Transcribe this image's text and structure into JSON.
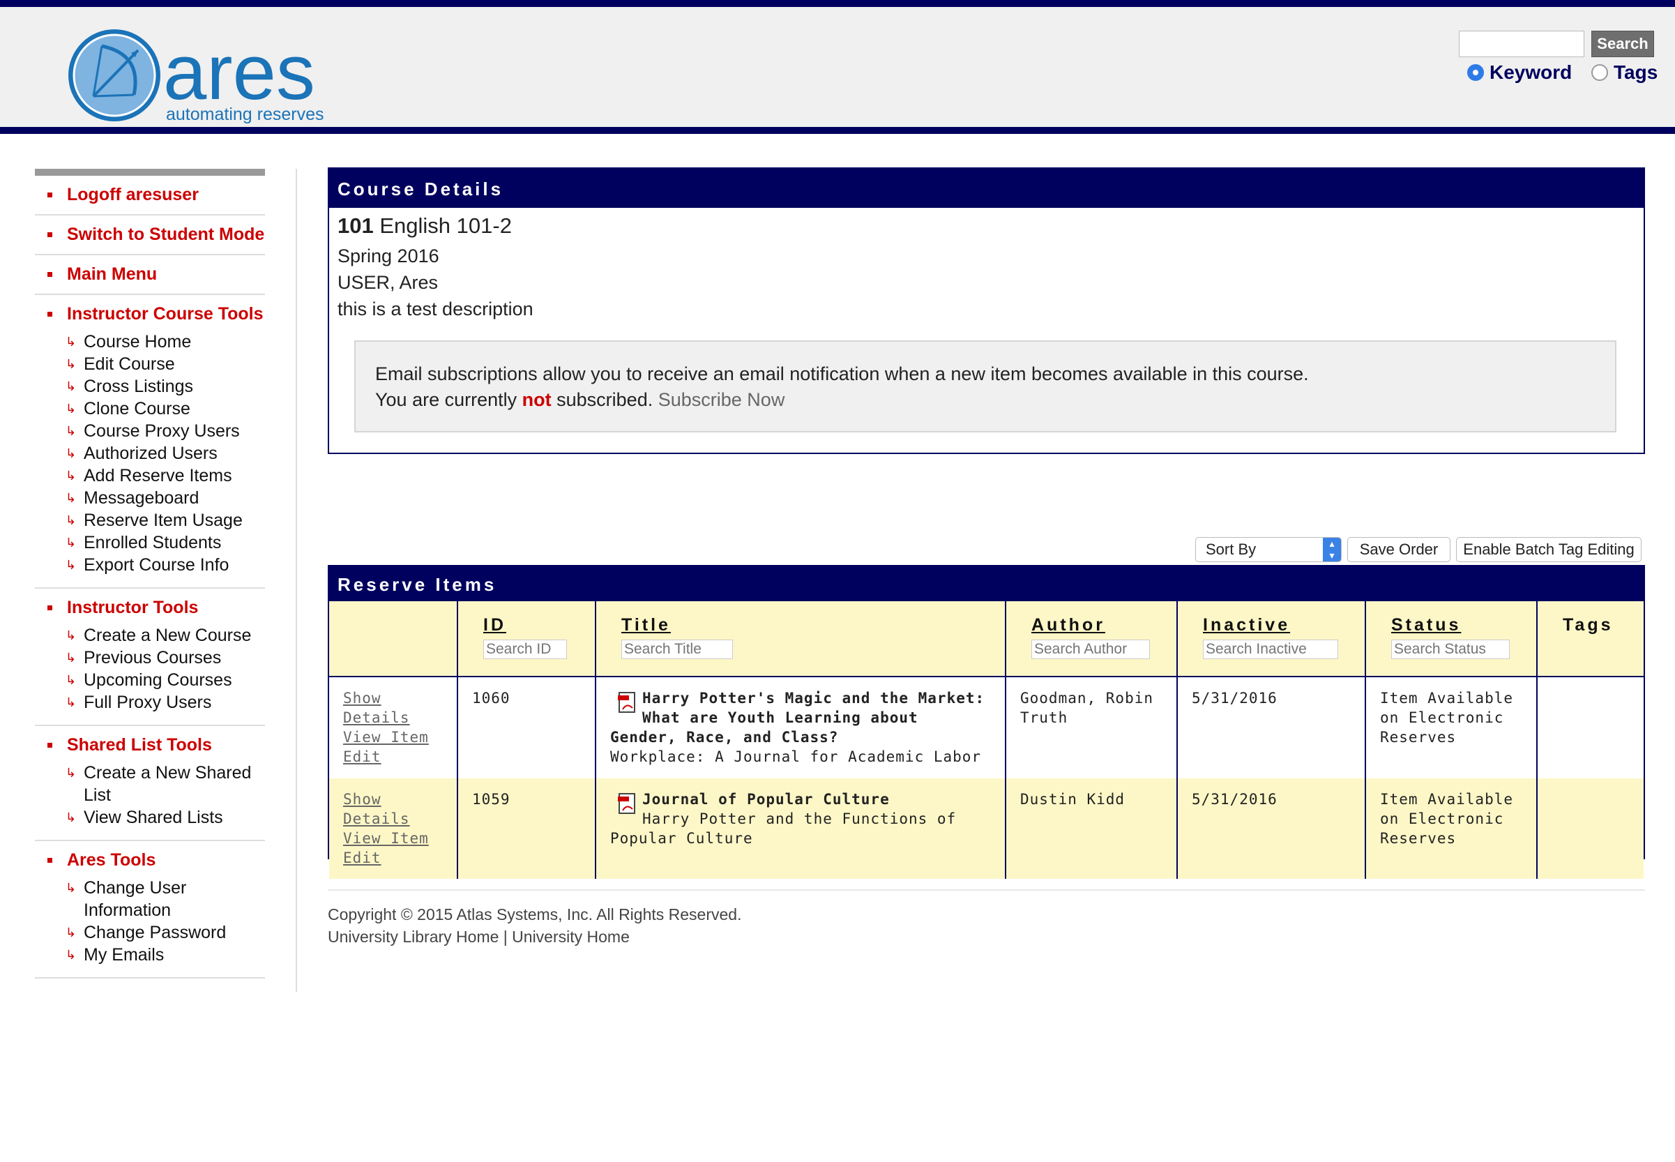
{
  "header": {
    "logo_text": "ares",
    "logo_tagline": "automating reserves",
    "search_value": "",
    "search_button": "Search",
    "radio_keyword": "Keyword",
    "radio_tags": "Tags",
    "selected_radio": "Keyword"
  },
  "sidebar": {
    "logoff": "Logoff aresuser",
    "switch_mode": "Switch to Student Mode",
    "main_menu": "Main Menu",
    "instructor_course_tools": {
      "title": "Instructor Course Tools",
      "items": [
        "Course Home",
        "Edit Course",
        "Cross Listings",
        "Clone Course",
        "Course Proxy Users",
        "Authorized Users",
        "Add Reserve Items",
        "Messageboard",
        "Reserve Item Usage",
        "Enrolled Students",
        "Export Course Info"
      ]
    },
    "instructor_tools": {
      "title": "Instructor Tools",
      "items": [
        "Create a New Course",
        "Previous Courses",
        "Upcoming Courses",
        "Full Proxy Users"
      ]
    },
    "shared_list_tools": {
      "title": "Shared List Tools",
      "items": [
        "Create a New Shared List",
        "View Shared Lists"
      ]
    },
    "ares_tools": {
      "title": "Ares Tools",
      "items": [
        "Change User Information",
        "Change Password",
        "My Emails"
      ]
    }
  },
  "course": {
    "panel_title": "Course Details",
    "number": "101",
    "name": "English 101-2",
    "semester": "Spring 2016",
    "instructor": "USER, Ares",
    "description": "this is a test description",
    "email_line1": "Email subscriptions allow you to receive an email notification when a new item becomes available in this course.",
    "email_line2_pre": "You are currently",
    "email_line2_not": "not",
    "email_line2_post": "subscribed.",
    "subscribe_link": "Subscribe Now"
  },
  "controls": {
    "sort_by": "Sort By",
    "save_order": "Save Order",
    "batch_tag": "Enable Batch Tag Editing"
  },
  "reserve": {
    "panel_title": "Reserve Items",
    "columns": {
      "id": "ID",
      "title": "Title",
      "author": "Author",
      "inactive": "Inactive",
      "status": "Status",
      "tags": "Tags"
    },
    "placeholders": {
      "id": "Search ID",
      "title": "Search Title",
      "author": "Search Author",
      "inactive": "Search Inactive",
      "status": "Search Status"
    },
    "rows": [
      {
        "actions": [
          "Show Details",
          "View Item",
          "Edit"
        ],
        "id": "1060",
        "title": "Harry Potter's Magic and the Market: What are Youth Learning about Gender, Race, and Class?",
        "subtitle": "Workplace: A Journal for Academic Labor",
        "author": "Goodman, Robin Truth",
        "inactive": "5/31/2016",
        "status": "Item Available on Electronic Reserves",
        "tags": ""
      },
      {
        "actions": [
          "Show Details",
          "View Item",
          "Edit"
        ],
        "id": "1059",
        "title": "Journal of Popular Culture",
        "subtitle": "Harry Potter and the Functions of Popular Culture",
        "author": "Dustin Kidd",
        "inactive": "5/31/2016",
        "status": "Item Available on Electronic Reserves",
        "tags": ""
      }
    ]
  },
  "footer": {
    "copyright": "Copyright © 2015 Atlas Systems, Inc. All Rights Reserved.",
    "link_library": "University Library Home",
    "separator": "|",
    "link_university": "University Home"
  },
  "colors": {
    "navy": "#00005e",
    "red": "#cc0000",
    "cream": "#fdf7c7",
    "logo_blue": "#1b73b8"
  }
}
